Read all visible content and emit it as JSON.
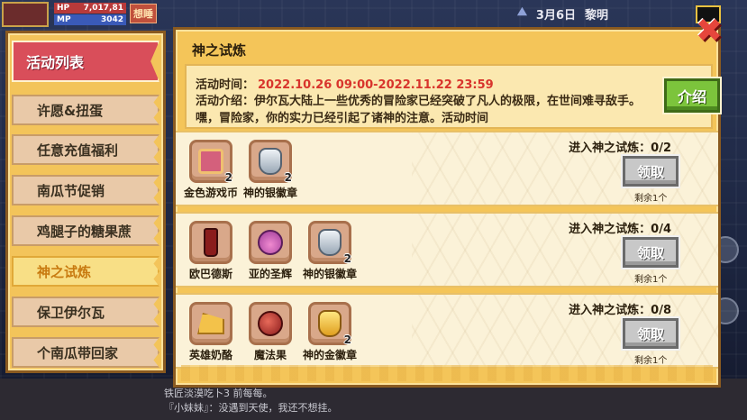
{
  "hud": {
    "hp_label": "HP",
    "hp_value": "7,017,81",
    "mp_label": "MP",
    "mp_value": "3042",
    "badge": "想睡",
    "date": "3月6日",
    "time_of_day": "黎明"
  },
  "sidebar": {
    "header": "活动列表",
    "items": [
      {
        "label": "许愿&扭蛋"
      },
      {
        "label": "任意充值福利"
      },
      {
        "label": "南瓜节促销"
      },
      {
        "label": "鸡腿子的糖果蔗"
      },
      {
        "label": "神之试炼"
      },
      {
        "label": "保卫伊尔瓦"
      },
      {
        "label": "个南瓜带回家"
      }
    ]
  },
  "panel": {
    "title": "神之试炼",
    "time_label": "活动时间：",
    "time_value": "2022.10.26 09:00-2022.11.22 23:59",
    "desc": "活动介绍：伊尔瓦大陆上一些优秀的冒险家已经突破了凡人的极限，在世间难寻敌手。嘿，冒险家，你的实力已经引起了诸神的注意。活动时间",
    "intro_button": "介绍"
  },
  "tasks": [
    {
      "progress": "进入神之试炼：0/2",
      "claim": "领取",
      "remain": "剩余1个",
      "rewards": [
        {
          "name": "金色游戏币",
          "count": "2",
          "icon": "gold-card-icon"
        },
        {
          "name": "神的银徽章",
          "count": "2",
          "icon": "silver-badge-icon"
        }
      ]
    },
    {
      "progress": "进入神之试炼：0/4",
      "claim": "领取",
      "remain": "剩余1个",
      "rewards": [
        {
          "name": "欧巴德斯",
          "count": "",
          "icon": "bottle-icon"
        },
        {
          "name": "亚的圣辉",
          "count": "",
          "icon": "potion-icon"
        },
        {
          "name": "神的银徽章",
          "count": "2",
          "icon": "silver-badge-icon"
        }
      ]
    },
    {
      "progress": "进入神之试炼：0/8",
      "claim": "领取",
      "remain": "剩余1个",
      "rewards": [
        {
          "name": "英雄奶酪",
          "count": "",
          "icon": "cheese-icon"
        },
        {
          "name": "魔法果",
          "count": "",
          "icon": "fruit-icon"
        },
        {
          "name": "神的金徽章",
          "count": "2",
          "icon": "gold-badge-icon"
        }
      ]
    }
  ],
  "chat": {
    "line1": "铁匠淡漠吃卜3 前每每。",
    "line2": "『小妹妹』：没遇到天使，我还不想挂。"
  },
  "colors": {
    "accent_red": "#d94e5a",
    "panel_gold": "#f4c559",
    "claim_gray": "#c8c8c8",
    "intro_green": "#7cc43c",
    "time_red": "#d8342c"
  }
}
